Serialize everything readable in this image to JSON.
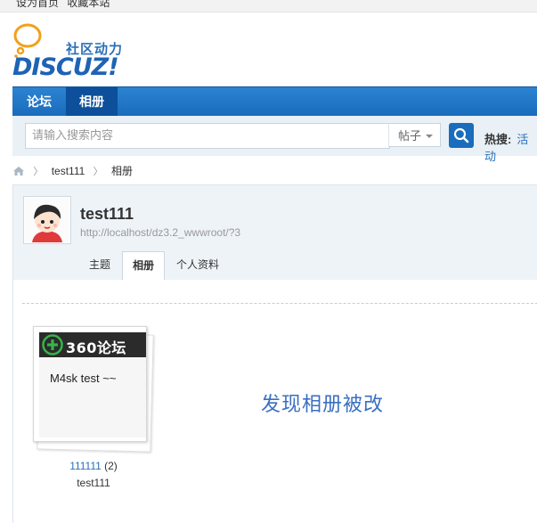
{
  "topbar": {
    "links": [
      "设为首页",
      "收藏本站"
    ]
  },
  "logo": {
    "cn_text": "社区动力",
    "word": "DISCUZ!"
  },
  "nav": {
    "items": [
      {
        "label": "论坛"
      },
      {
        "label": "相册"
      }
    ]
  },
  "search": {
    "placeholder": "请输入搜索内容",
    "scope": "帖子",
    "hot_label": "热搜:",
    "hot_link": "活动"
  },
  "breadcrumb": {
    "home": "home",
    "items": [
      "test111",
      "相册"
    ]
  },
  "profile": {
    "username": "test111",
    "url": "http://localhost/dz3.2_wwwroot/?3",
    "tabs": [
      "主题",
      "相册",
      "个人资料"
    ]
  },
  "album": {
    "cover_brand": "360论坛",
    "cover_caption": "M4sk test ~~",
    "title": "111111",
    "count": "(2)",
    "owner": "test111"
  },
  "notice": "发现相册被改",
  "colors": {
    "accent": "#1a6cbc",
    "link": "#2b6fb8",
    "notice": "#3a6fc2"
  }
}
